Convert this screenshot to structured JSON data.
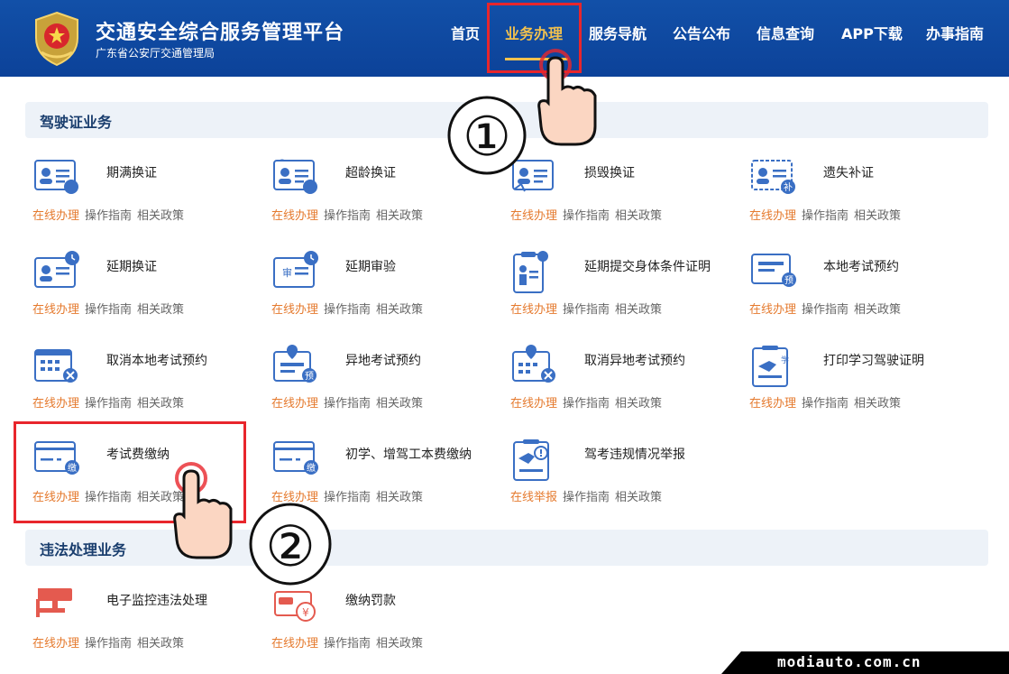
{
  "header": {
    "title": "交通安全综合服务管理平台",
    "subtitle": "广东省公安厅交通管理局",
    "nav": [
      "首页",
      "业务办理",
      "服务导航",
      "公告公布",
      "信息查询",
      "APP下载",
      "办事指南"
    ],
    "active_nav": "业务办理"
  },
  "sections": {
    "license": "驾驶证业务",
    "violation": "违法处理业务"
  },
  "links": {
    "online": "在线办理",
    "online_report": "在线举报",
    "guide": "操作指南",
    "policy": "相关政策"
  },
  "services": {
    "s0": "期满换证",
    "s1": "超龄换证",
    "s2": "损毁换证",
    "s3": "遗失补证",
    "s4": "延期换证",
    "s5": "延期审验",
    "s6": "延期提交身体条件证明",
    "s7": "本地考试预约",
    "s8": "取消本地考试预约",
    "s9": "异地考试预约",
    "s10": "取消异地考试预约",
    "s11": "打印学习驾驶证明",
    "s12": "考试费缴纳",
    "s13": "初学、增驾工本费缴纳",
    "s14": "驾考违规情况举报",
    "v0": "电子监控违法处理",
    "v1": "缴纳罚款"
  },
  "icon_badges": {
    "bu": "补",
    "shen": "审",
    "yu": "预",
    "xue": "学",
    "jiao": "缴"
  },
  "annotations": {
    "step1": "①",
    "step2": "②"
  },
  "watermark": "modiauto.com.cn",
  "colors": {
    "header_bg": "#0c4299",
    "active_nav": "#f2c14e",
    "online_link": "#e57a2e",
    "icon_blue": "#3a6fc4",
    "highlight_red": "#e8262c"
  }
}
